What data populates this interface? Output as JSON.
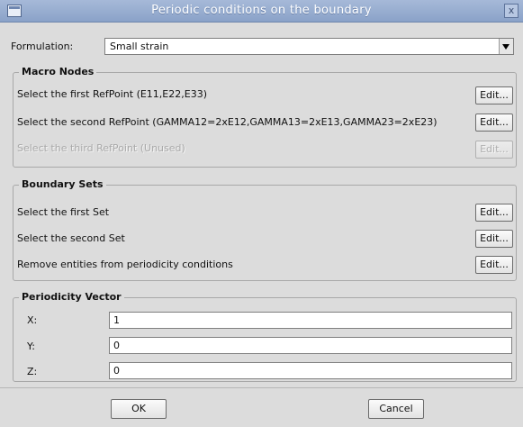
{
  "window": {
    "title": "Periodic conditions on the boundary",
    "close_label": "x"
  },
  "formulation": {
    "label": "Formulation:",
    "value": "Small strain"
  },
  "macro_nodes": {
    "title": "Macro Nodes",
    "rows": [
      {
        "label": "Select the first RefPoint (E11,E22,E33)",
        "button": "Edit...",
        "enabled": true
      },
      {
        "label": "Select the second RefPoint (GAMMA12=2xE12,GAMMA13=2xE13,GAMMA23=2xE23)",
        "button": "Edit...",
        "enabled": true
      },
      {
        "label": "Select the third RefPoint (Unused)",
        "button": "Edit...",
        "enabled": false
      }
    ]
  },
  "boundary_sets": {
    "title": "Boundary Sets",
    "rows": [
      {
        "label": "Select the first Set",
        "button": "Edit..."
      },
      {
        "label": "Select the second Set",
        "button": "Edit..."
      },
      {
        "label": "Remove entities from periodicity conditions",
        "button": "Edit..."
      }
    ]
  },
  "periodicity_vector": {
    "title": "Periodicity Vector",
    "fields": [
      {
        "label": "X:",
        "value": "1"
      },
      {
        "label": "Y:",
        "value": "0"
      },
      {
        "label": "Z:",
        "value": "0"
      }
    ]
  },
  "footer": {
    "ok": "OK",
    "cancel": "Cancel"
  }
}
